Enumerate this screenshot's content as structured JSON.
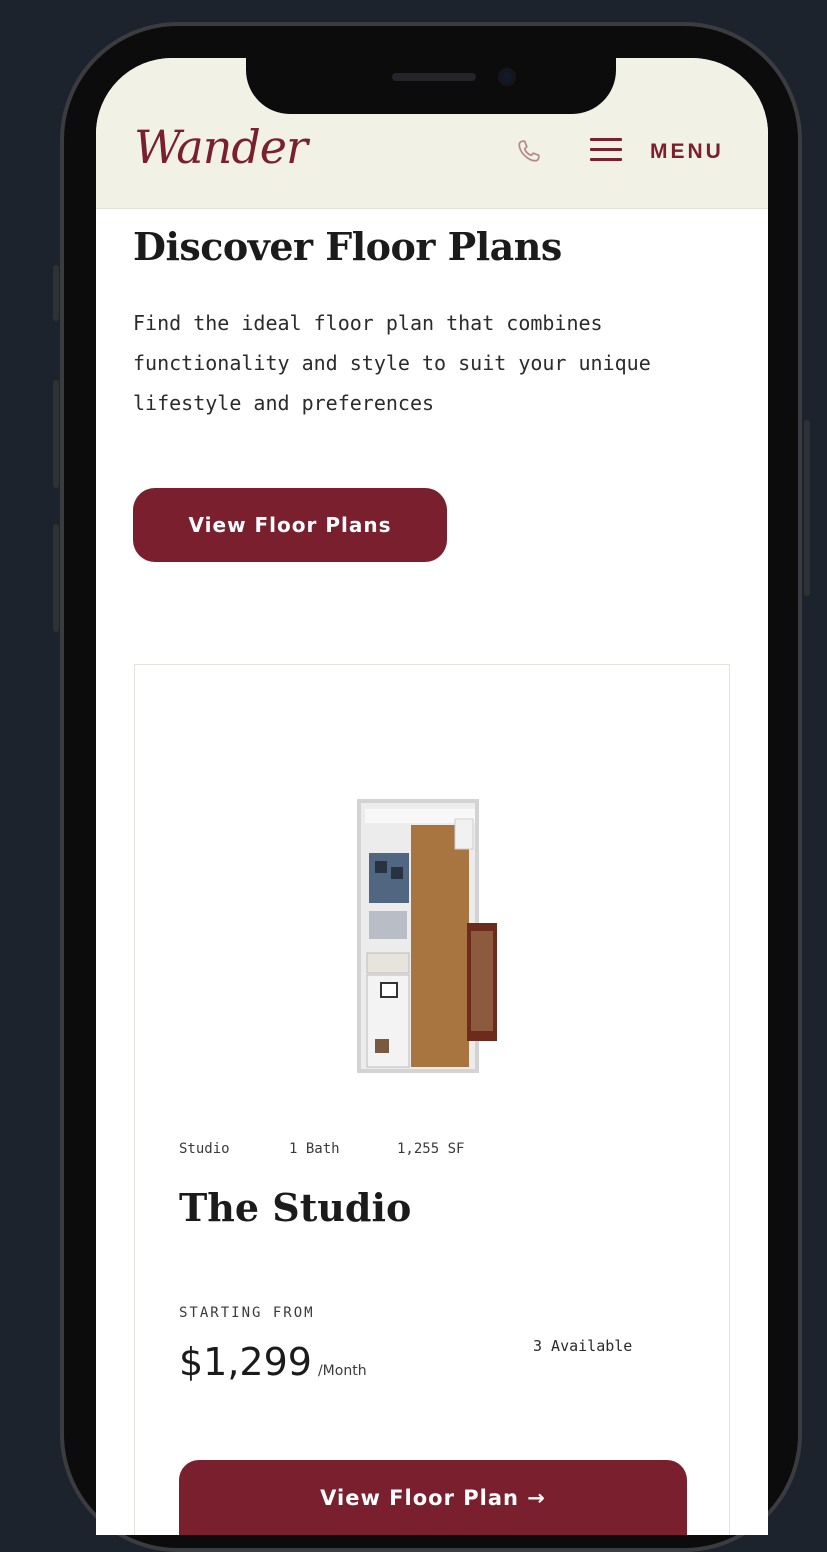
{
  "header": {
    "logo_text": "Wander",
    "phone_icon": "phone-icon",
    "menu_icon": "hamburger-icon",
    "menu_label": "MENU",
    "brand_color": "#7a1f2e"
  },
  "hero": {
    "title": "Discover Floor Plans",
    "description": "Find the ideal floor plan that combines functionality and style to suit your unique lifestyle and preferences",
    "cta_label": "View Floor Plans"
  },
  "card": {
    "type": "Studio",
    "baths": "1 Bath",
    "size": "1,255 SF",
    "title": "The Studio",
    "starting_label": "STARTING FROM",
    "price": "$1,299",
    "price_unit": "/Month",
    "availability": "3 Available",
    "button_label": "View Floor Plan →"
  }
}
